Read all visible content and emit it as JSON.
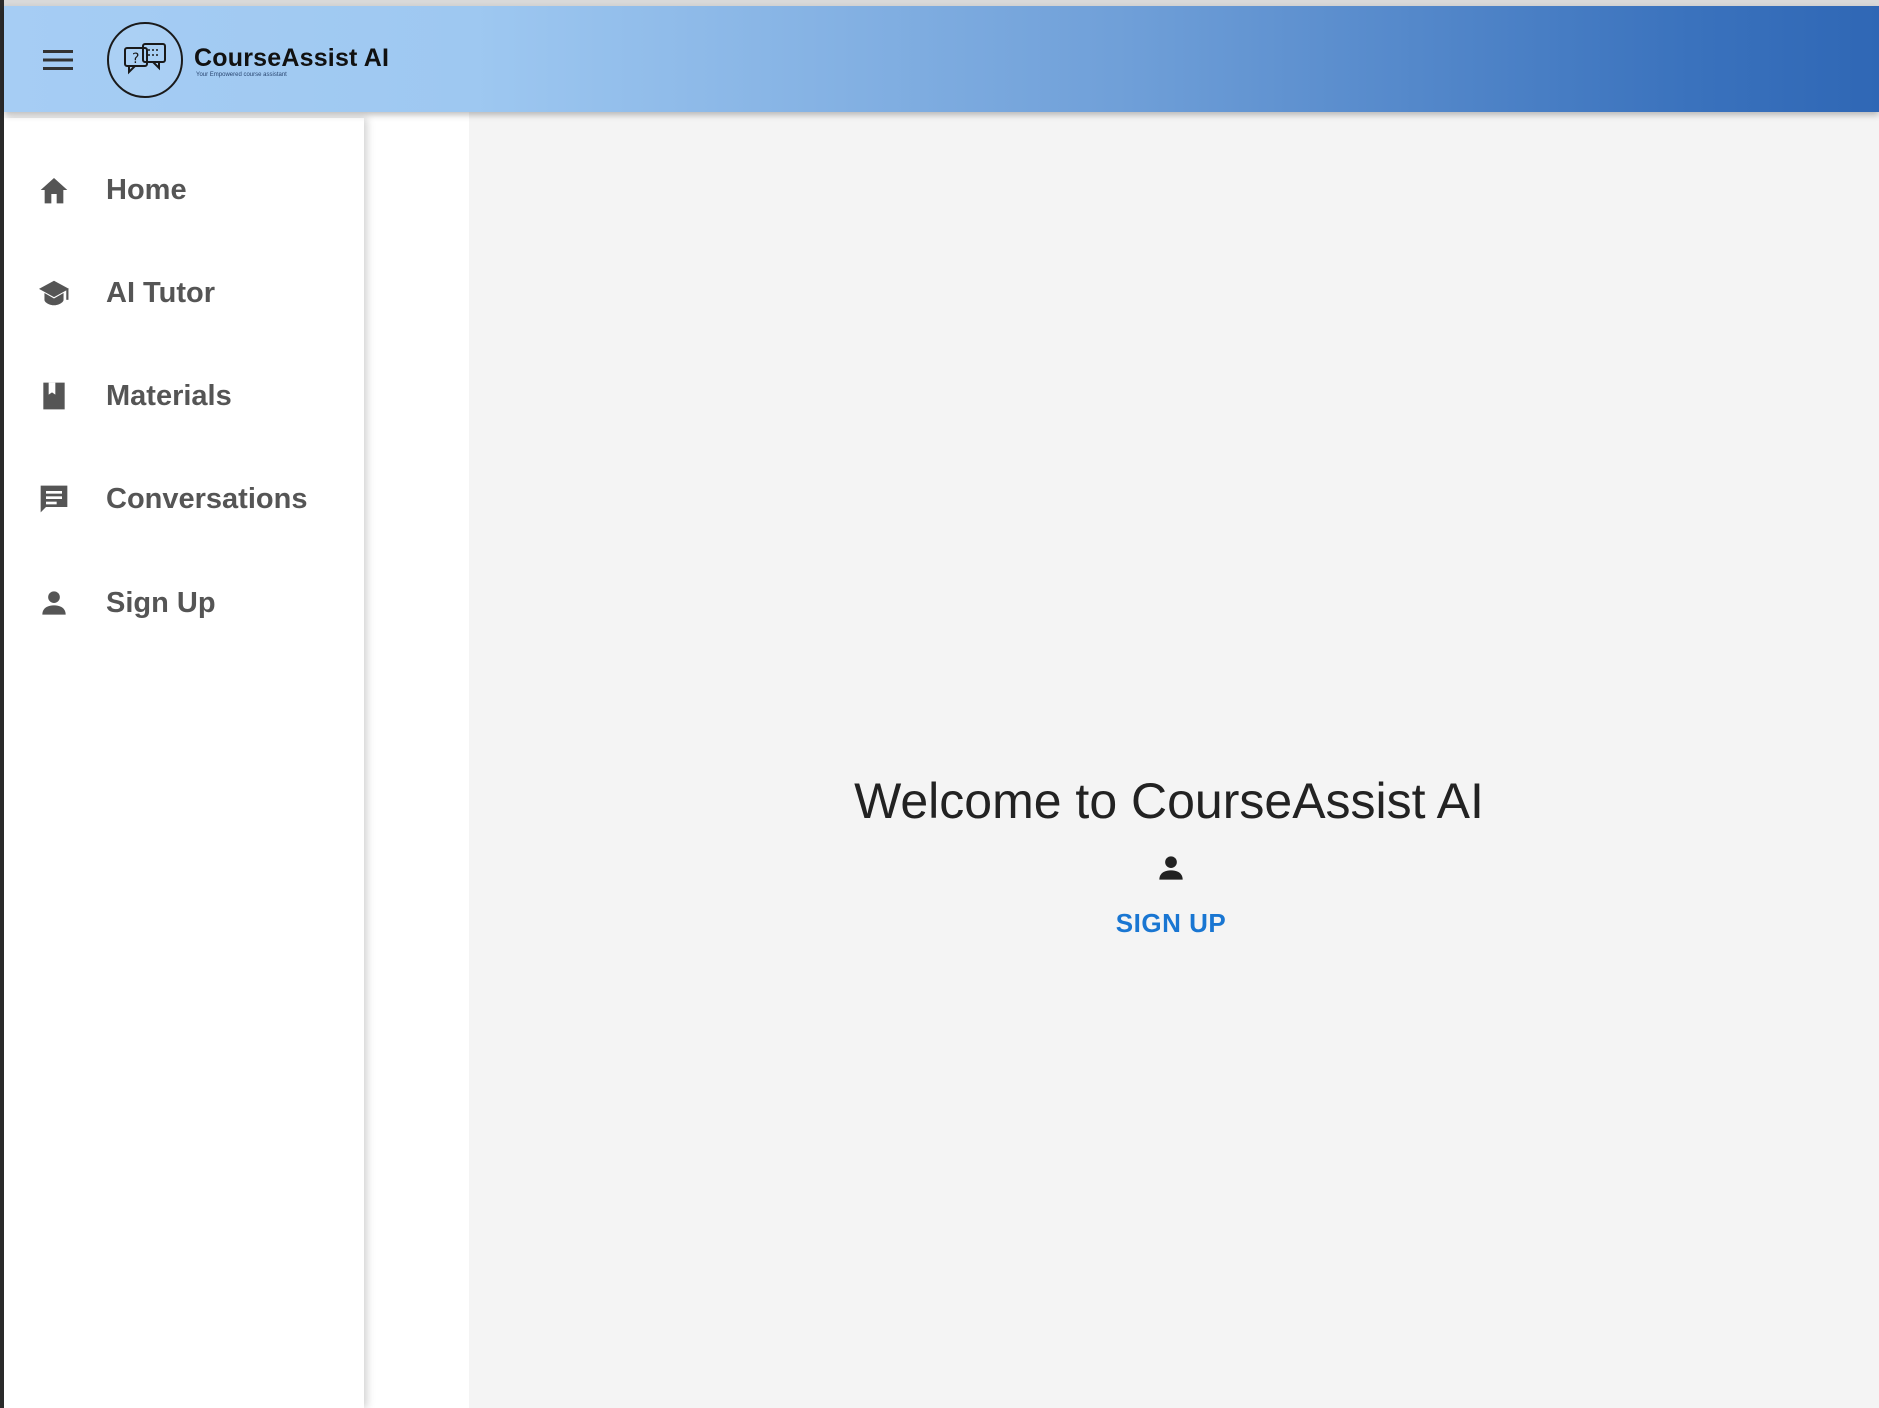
{
  "app": {
    "name": "CourseAssist AI",
    "tagline": "Your Empowered course assistant"
  },
  "header": {
    "menu_icon": "hamburger-menu-icon",
    "logo_icon": "chat-bubbles-question-icon"
  },
  "sidebar": {
    "items": [
      {
        "label": "Home",
        "icon": "home-icon"
      },
      {
        "label": "AI Tutor",
        "icon": "graduation-cap-icon"
      },
      {
        "label": "Materials",
        "icon": "book-icon"
      },
      {
        "label": "Conversations",
        "icon": "chat-icon"
      },
      {
        "label": "Sign Up",
        "icon": "person-icon"
      }
    ]
  },
  "main": {
    "welcome": "Welcome to CourseAssist AI",
    "signup_icon": "person-icon",
    "signup_label": "SIGN UP"
  },
  "colors": {
    "header_gradient_start": "#a6cdf4",
    "header_gradient_end": "#2f67b5",
    "nav_text": "#555555",
    "link_accent": "#1976d2",
    "main_background": "#f4f4f4"
  }
}
